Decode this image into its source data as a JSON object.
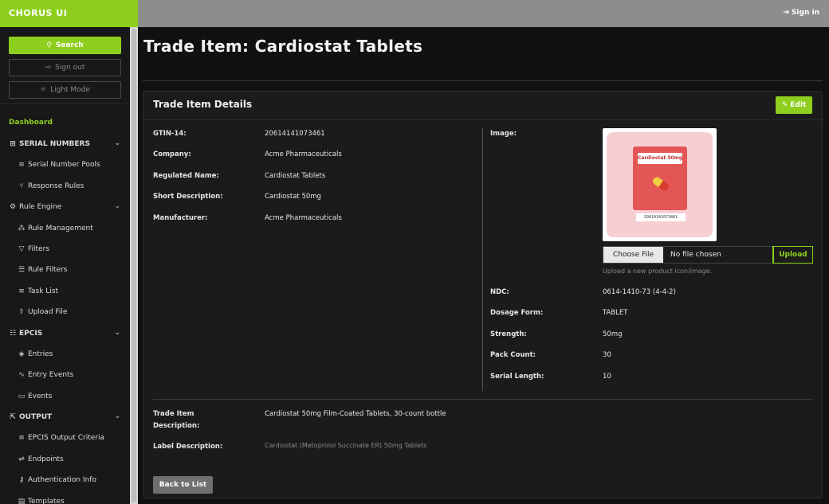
{
  "app": {
    "brand": "CHORUS UI",
    "sign_in": "Sign in"
  },
  "sidebar": {
    "search_label": "Search",
    "signout_label": "Sign out",
    "lightmode_label": "Light Mode",
    "dashboard": "Dashboard",
    "sections": {
      "serial": "SERIAL NUMBERS",
      "rule_engine": "Rule Engine",
      "epcis": "EPCIS",
      "output": "OUTPUT"
    },
    "items": {
      "serial_pools": "Serial Number Pools",
      "response_rules": "Response Rules",
      "rule_management": "Rule Management",
      "filters": "Filters",
      "rule_filters": "Rule Filters",
      "task_list": "Task List",
      "upload_file": "Upload File",
      "entries": "Entries",
      "entry_events": "Entry Events",
      "events": "Events",
      "epcis_output_criteria": "EPCIS Output Criteria",
      "endpoints": "Endpoints",
      "auth_info": "Authentication Info",
      "templates": "Templates"
    }
  },
  "page": {
    "title": "Trade Item: Cardiostat Tablets"
  },
  "card": {
    "title": "Trade Item Details",
    "edit_label": "Edit",
    "fields_left": {
      "gtin_label": "GTIN-14:",
      "gtin_value": "20614141073461",
      "company_label": "Company:",
      "company_value": "Acme Pharmaceuticals",
      "regname_label": "Regulated Name:",
      "regname_value": "Cardiostat Tablets",
      "shortdesc_label": "Short Description:",
      "shortdesc_value": "Cardiostat 50mg",
      "manufacturer_label": "Manufacturer:",
      "manufacturer_value": "Acme Pharmaceuticals"
    },
    "image": {
      "label": "Image:",
      "pack_text": "Cardiostat 50mg",
      "barcode_text": "20614141073461",
      "choose_file": "Choose File",
      "no_file": "No file chosen",
      "upload": "Upload",
      "hint": "Upload a new product icon/image."
    },
    "fields_right": {
      "ndc_label": "NDC:",
      "ndc_value": "0614-1410-73 (4-4-2)",
      "dosage_label": "Dosage Form:",
      "dosage_value": "TABLET",
      "strength_label": "Strength:",
      "strength_value": "50mg",
      "pack_label": "Pack Count:",
      "pack_value": "30",
      "serial_label": "Serial Length:",
      "serial_value": "10"
    },
    "bottom": {
      "trade_desc_label_1": "Trade Item",
      "trade_desc_label_2": "Description:",
      "trade_desc_value": "Cardiostat 50mg Film-Coated Tablets, 30-count bottle",
      "label_desc_label": "Label Description:",
      "label_desc_value": "Cardiostat (Metoprolol Succinate ER) 50mg Tablets"
    },
    "back_label": "Back to List"
  },
  "colors": {
    "accent": "#8ecf1e",
    "topbar": "#8d8d8d",
    "background": "#111111"
  }
}
